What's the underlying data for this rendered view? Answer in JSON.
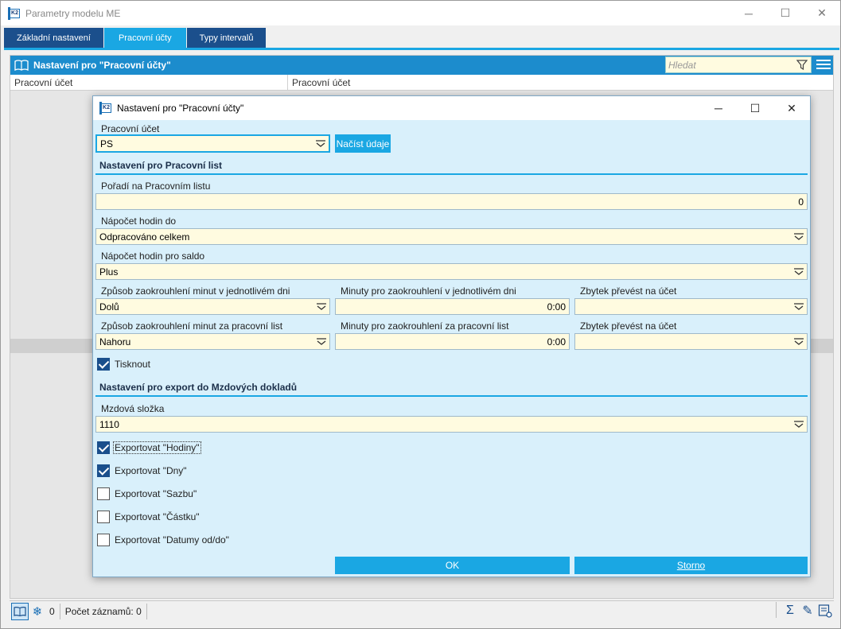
{
  "window": {
    "title": "Parametry modelu ME",
    "minimize_glyph": "─",
    "maximize_glyph": "☐",
    "close_glyph": "✕"
  },
  "tabs": [
    {
      "label": "Základní nastavení",
      "active": false
    },
    {
      "label": "Pracovní účty",
      "active": true
    },
    {
      "label": "Typy intervalů",
      "active": false
    }
  ],
  "panel": {
    "title": "Nastavení pro \"Pracovní účty\"",
    "search_placeholder": "Hledat",
    "columns": [
      "Pracovní účet",
      "Pracovní účet"
    ]
  },
  "statusbar": {
    "count_zero": "0",
    "records_label": "Počet záznamů: 0",
    "sigma_glyph": "Σ",
    "snowflake_glyph": "❄",
    "edit_glyph": "✎"
  },
  "dialog": {
    "title": "Nastavení pro \"Pracovní účty\"",
    "minimize_glyph": "─",
    "maximize_glyph": "☐",
    "close_glyph": "✕",
    "account_label": "Pracovní účet",
    "account_value": "PS",
    "load_button": "Načíst údaje",
    "section_worksheet": "Nastavení pro Pracovní list",
    "order_label": "Pořadí na Pracovním listu",
    "order_value": "0",
    "hours_to_label": "Nápočet hodin do",
    "hours_to_value": "Odpracováno celkem",
    "hours_saldo_label": "Nápočet hodin pro saldo",
    "hours_saldo_value": "Plus",
    "round_day_label": "Způsob zaokrouhlení minut v jednotlivém dni",
    "round_day_value": "Dolů",
    "minutes_day_label": "Minuty pro zaokrouhlení v jednotlivém dni",
    "minutes_day_value": "0:00",
    "rest_day_label": "Zbytek převést na účet",
    "rest_day_value": "",
    "round_sheet_label": "Způsob zaokrouhlení minut za pracovní list",
    "round_sheet_value": "Nahoru",
    "minutes_sheet_label": "Minuty pro zaokrouhlení za pracovní list",
    "minutes_sheet_value": "0:00",
    "rest_sheet_label": "Zbytek převést na účet",
    "rest_sheet_value": "",
    "print_label": "Tisknout",
    "print_checked": true,
    "section_export": "Nastavení pro export do Mzdových dokladů",
    "wage_label": "Mzdová složka",
    "wage_value": "1110",
    "exports": [
      {
        "label": "Exportovat \"Hodiny\"",
        "checked": true
      },
      {
        "label": "Exportovat \"Dny\"",
        "checked": true
      },
      {
        "label": "Exportovat \"Sazbu\"",
        "checked": false
      },
      {
        "label": "Exportovat \"Částku\"",
        "checked": false
      },
      {
        "label": "Exportovat \"Datumy od/do\"",
        "checked": false
      }
    ],
    "ok_button": "OK",
    "cancel_button": "Storno"
  },
  "colors": {
    "accent": "#1aa7e3",
    "dark_tab": "#1b4f8c",
    "panel_head": "#1c8ccd",
    "dialog_bg": "#d9f0fb",
    "field_bg": "#fffbe0"
  }
}
